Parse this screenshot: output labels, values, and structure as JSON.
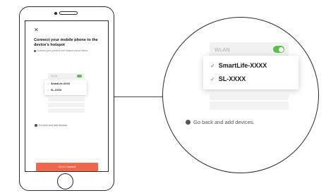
{
  "screen": {
    "close_icon": "close-icon",
    "title": "Connect your mobile phone to the device's hotspot",
    "hint": "Connect your phone to the hotspot shown below",
    "wlan_label": "WLAN",
    "wlan_enabled": true,
    "networks": [
      "SmartLife-XXXX",
      "SL-XXXX"
    ],
    "go_back_text": "Go back and add devices.",
    "button_label": "Go to Connect",
    "button_color": "#f0674d",
    "toggle_color": "#55c04a",
    "check_color": "#3a7bd5"
  },
  "zoom": {
    "wlan_label": "WLAN",
    "networks": [
      "SmartLife-XXXX",
      "SL-XXXX"
    ],
    "go_back_text": "Go back and add devices."
  }
}
